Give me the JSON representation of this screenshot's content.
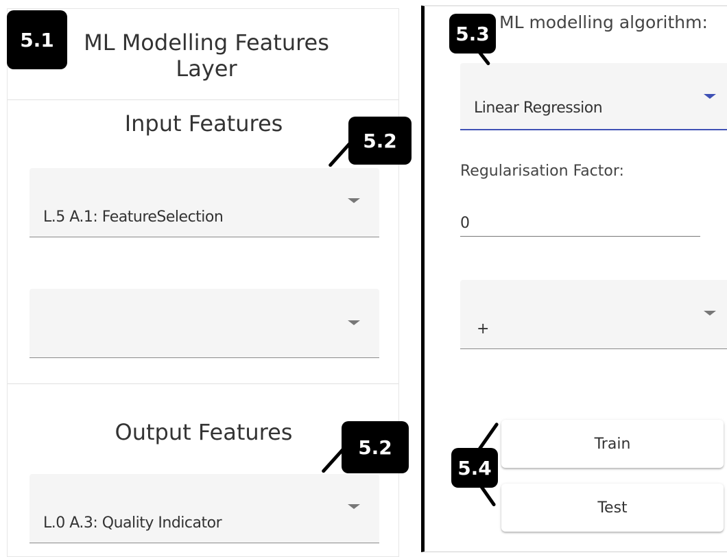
{
  "left": {
    "title": "ML Modelling Features Layer",
    "input_heading": "Input Features",
    "input_select_1": "L.5 A.1: FeatureSelection",
    "input_select_2": "",
    "output_heading": "Output Features",
    "output_select_1": "L.0 A.3: Quality Indicator"
  },
  "right": {
    "algorithm_label": "ML modelling algorithm:",
    "algorithm_value": "Linear Regression",
    "regularisation_label": "Regularisation Factor:",
    "regularisation_value": "0",
    "operator_value": "+",
    "train_label": "Train",
    "test_label": "Test"
  },
  "annotations": {
    "a1": "5.1",
    "a2": "5.2",
    "a3": "5.3",
    "a4": "5.4"
  },
  "colors": {
    "focus_underline": "#3f51b5",
    "badge": "#000000"
  }
}
